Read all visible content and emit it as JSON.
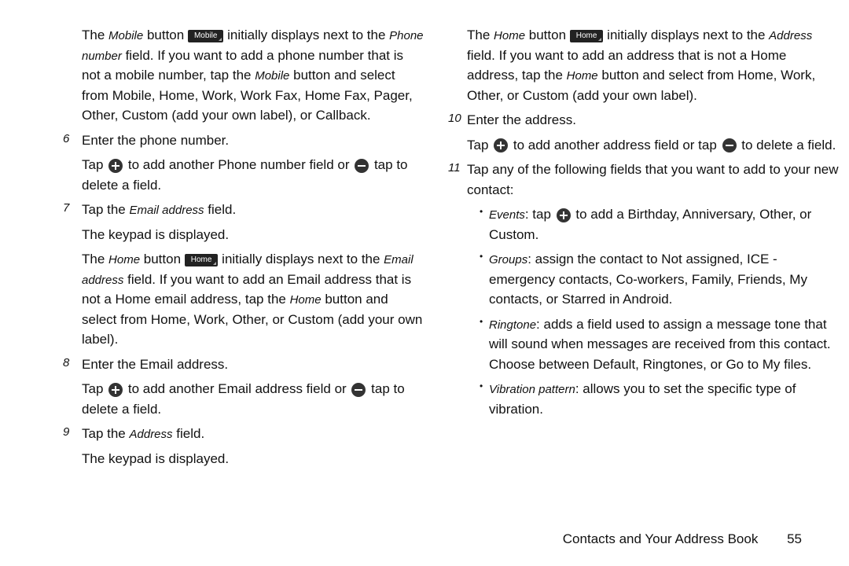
{
  "left": {
    "p1a": "The ",
    "p1b_i": "Mobile",
    "p1c": " button ",
    "chipMobile": "Mobile",
    "p1d": " initially displays next to the ",
    "p2a_i": "Phone number",
    "p2b": " field. If you want to add a phone number that is not a mobile number, tap the ",
    "p2c_i": "Mobile",
    "p2d": " button and select from Mobile, Home, Work, Work Fax, Home Fax, Pager, Other, Custom (add your own label), or Callback.",
    "s6n": "6",
    "s6a": "Enter the phone number.",
    "s6b1": "Tap ",
    "s6b2": " to add another Phone number field or ",
    "s6b3": " tap to delete a field.",
    "s7n": "7",
    "s7a": "Tap the ",
    "s7a_i": "Email address",
    "s7b": " field.",
    "s7c": "The keypad is displayed.",
    "s7d": "The ",
    "s7d_i": "Home",
    "s7e": " button ",
    "chipHome": "Home",
    "s7f": " initially displays next to the ",
    "s7g_i": "Email address",
    "s7h": " field. If you want to add an Email address that is not a Home email address, tap the ",
    "s7h_i": "Home",
    "s7i": " button and select from Home, Work, Other, or Custom (add your own label).",
    "s8n": "8",
    "s8a": "Enter the Email address.",
    "s8b1": "Tap ",
    "s8b2": " to add another Email address field or ",
    "s8b3": " tap to delete a field.",
    "s9n": "9",
    "s9a": "Tap the ",
    "s9a_i": "Address",
    "s9b": " field.",
    "s9c": "The keypad is displayed."
  },
  "right": {
    "p1a": "The ",
    "p1a_i": "Home",
    "p1b": " button ",
    "chipHome": "Home",
    "p1c": " initially displays next to the ",
    "p2a_i": "Address",
    "p2b": " field. If you want to add an address that is not a Home address, tap the ",
    "p2b_i": "Home",
    "p2c": " button and select from Home, Work, Other, or Custom (add your own label).",
    "s10n": "10",
    "s10a": "Enter the address.",
    "s10b1": "Tap ",
    "s10b2": " to add another address field or tap ",
    "s10b3": " to delete a field.",
    "s11n": "11",
    "s11a": "Tap any of the following fields that you want to add to your new contact:",
    "b1_i": "Events",
    "b1a": ": tap ",
    "b1b": " to add a Birthday, Anniversary, Other, or Custom.",
    "b2_i": "Groups",
    "b2": ": assign the contact to Not assigned, ICE - emergency contacts, Co-workers, Family, Friends, My contacts, or Starred in Android.",
    "b3_i": "Ringtone",
    "b3": ": adds a field used to assign a message tone that will sound when messages are received from this contact. Choose between Default, Ringtones, or Go to My files.",
    "b4_i": "Vibration pattern",
    "b4": ": allows you to set the specific type of vibration."
  },
  "footer": {
    "section": "Contacts and Your Address Book",
    "page": "55"
  }
}
